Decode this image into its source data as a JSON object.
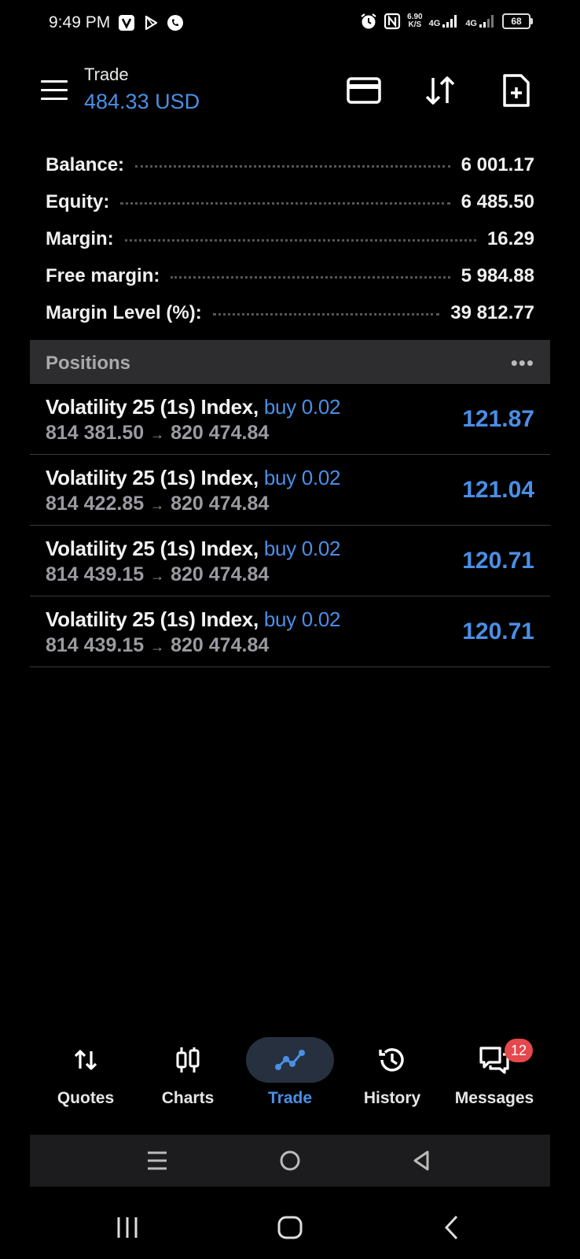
{
  "status_bar": {
    "time": "9:49 PM",
    "net_speed_value": "6.90",
    "net_speed_unit": "K/S",
    "net1": "4G",
    "net2": "4G",
    "battery": "68"
  },
  "header": {
    "title": "Trade",
    "subtitle": "484.33 USD"
  },
  "summary": [
    {
      "label": "Balance:",
      "value": "6 001.17"
    },
    {
      "label": "Equity:",
      "value": "6 485.50"
    },
    {
      "label": "Margin:",
      "value": "16.29"
    },
    {
      "label": "Free margin:",
      "value": "5 984.88"
    },
    {
      "label": "Margin Level (%):",
      "value": "39 812.77"
    }
  ],
  "positions_header": {
    "title": "Positions",
    "more": "•••"
  },
  "positions": [
    {
      "symbol": "Volatility 25 (1s) Index,",
      "side": "buy 0.02",
      "open": "814 381.50",
      "arrow": "→",
      "current": "820 474.84",
      "profit": "121.87"
    },
    {
      "symbol": "Volatility 25 (1s) Index,",
      "side": "buy 0.02",
      "open": "814 422.85",
      "arrow": "→",
      "current": "820 474.84",
      "profit": "121.04"
    },
    {
      "symbol": "Volatility 25 (1s) Index,",
      "side": "buy 0.02",
      "open": "814 439.15",
      "arrow": "→",
      "current": "820 474.84",
      "profit": "120.71"
    },
    {
      "symbol": "Volatility 25 (1s) Index,",
      "side": "buy 0.02",
      "open": "814 439.15",
      "arrow": "→",
      "current": "820 474.84",
      "profit": "120.71"
    }
  ],
  "bottom_nav": [
    {
      "label": "Quotes",
      "icon": "quotes-arrows-icon"
    },
    {
      "label": "Charts",
      "icon": "candlestick-icon"
    },
    {
      "label": "Trade",
      "icon": "trend-line-icon",
      "active": true
    },
    {
      "label": "History",
      "icon": "history-clock-icon"
    },
    {
      "label": "Messages",
      "icon": "chat-icon",
      "badge": "12"
    }
  ],
  "colors": {
    "accent": "#4a8fe7",
    "badge": "#e5484d",
    "header_band": "#2d2d2f"
  }
}
